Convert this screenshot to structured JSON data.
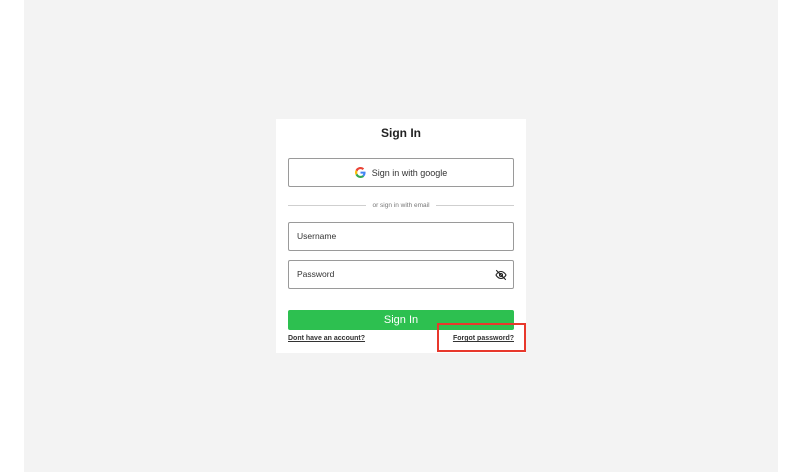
{
  "card": {
    "title": "Sign In"
  },
  "google": {
    "label": "Sign in with google"
  },
  "divider": {
    "text": "or sign in with email"
  },
  "username": {
    "placeholder": "Username",
    "value": ""
  },
  "password": {
    "placeholder": "Password",
    "value": ""
  },
  "submit": {
    "label": "Sign In"
  },
  "links": {
    "no_account": "Dont have an account?",
    "forgot": "Forgot password?"
  },
  "colors": {
    "background": "#f3f3f3",
    "card": "#ffffff",
    "primary_button": "#2dc050",
    "highlight": "#e8382c"
  },
  "icons": {
    "google": "google-g-icon",
    "password_toggle": "eye-slash-icon"
  }
}
